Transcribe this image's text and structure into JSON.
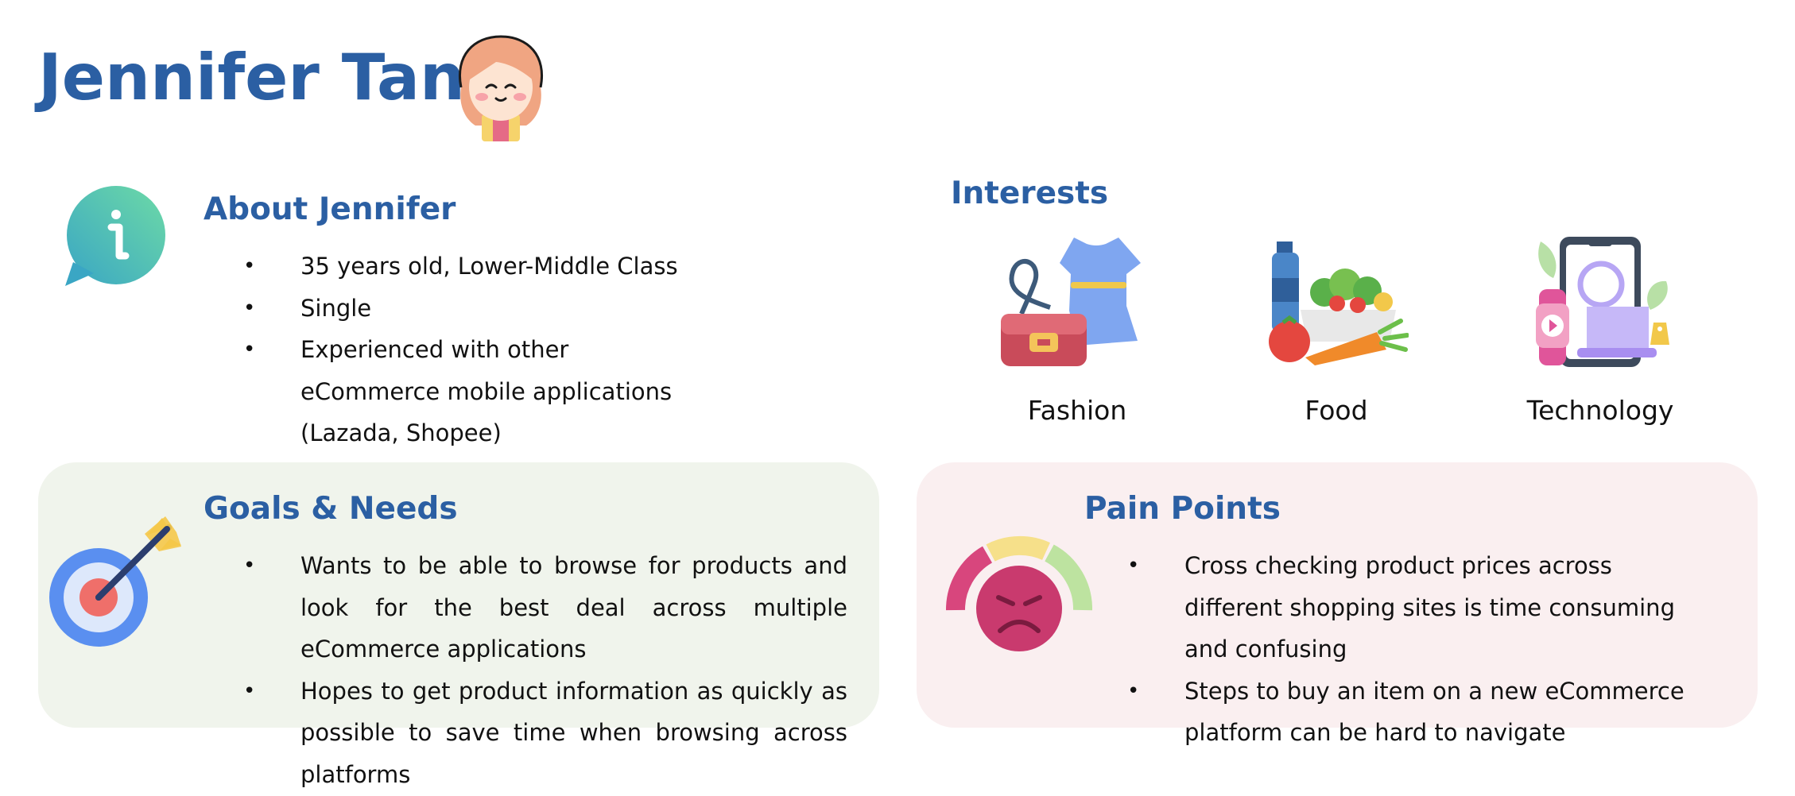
{
  "persona": {
    "name": "Jennifer Tan",
    "avatar_icon": "girl-avatar-icon"
  },
  "about": {
    "heading": "About Jennifer",
    "icon": "info-bubble-icon",
    "items": [
      "35 years old, Lower-Middle Class",
      "Single",
      "Experienced with other eCommerce mobile applications (Lazada, Shopee)"
    ]
  },
  "interests": {
    "heading": "Interests",
    "items": [
      {
        "label": "Fashion",
        "icon": "fashion-icon"
      },
      {
        "label": "Food",
        "icon": "food-icon"
      },
      {
        "label": "Technology",
        "icon": "technology-icon"
      }
    ]
  },
  "goals": {
    "heading": "Goals & Needs",
    "icon": "target-icon",
    "bg": "#f0f4ec",
    "items": [
      "Wants to be able to browse for products and look for the best deal across multiple eCommerce applications",
      "Hopes to get product information as quickly as possible to save time when browsing across platforms"
    ]
  },
  "pain_points": {
    "heading": "Pain Points",
    "icon": "frustrated-face-gauge-icon",
    "bg": "#faeff0",
    "items": [
      "Cross checking product prices across different shopping sites is time consuming and confusing",
      "Steps to buy an item on a new eCommerce platform can be hard to navigate"
    ]
  },
  "colors": {
    "heading_blue": "#2b5fa3",
    "text": "#111111"
  }
}
